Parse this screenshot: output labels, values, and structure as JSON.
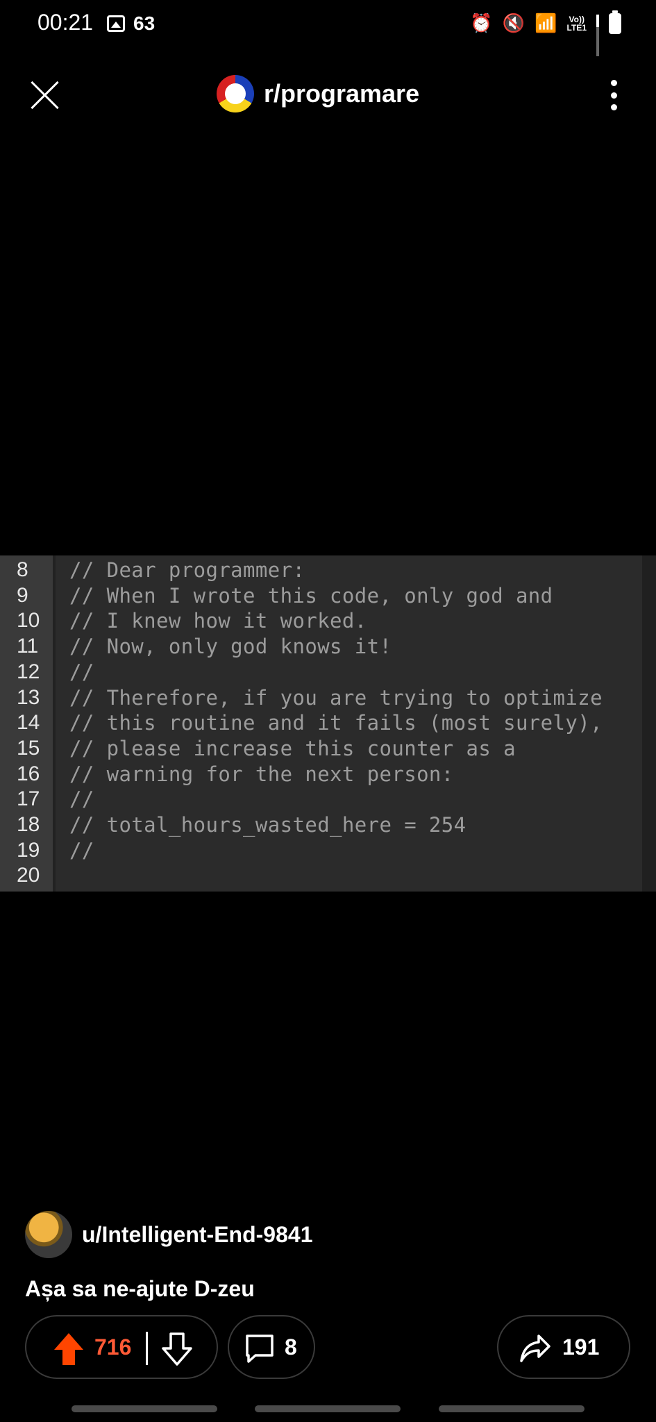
{
  "status_bar": {
    "time": "00:21",
    "notification_count": "63",
    "network_label_top": "Vo))",
    "network_label_bottom": "LTE1"
  },
  "header": {
    "subreddit": "r/programare",
    "icons": [
      "close-icon",
      "more-icon"
    ]
  },
  "code_image": {
    "lines": [
      {
        "num": "8",
        "text": "// Dear programmer:"
      },
      {
        "num": "9",
        "text": "// When I wrote this code, only god and"
      },
      {
        "num": "10",
        "text": "// I knew how it worked."
      },
      {
        "num": "11",
        "text": "// Now, only god knows it!"
      },
      {
        "num": "12",
        "text": "//"
      },
      {
        "num": "13",
        "text": "// Therefore, if you are trying to optimize"
      },
      {
        "num": "14",
        "text": "// this routine and it fails (most surely),"
      },
      {
        "num": "15",
        "text": "// please increase this counter as a"
      },
      {
        "num": "16",
        "text": "// warning for the next person:"
      },
      {
        "num": "17",
        "text": "//"
      },
      {
        "num": "18",
        "text": "// total_hours_wasted_here = 254"
      },
      {
        "num": "19",
        "text": "//"
      },
      {
        "num": "20",
        "text": ""
      }
    ]
  },
  "post": {
    "author": "u/Intelligent-End-9841",
    "title": "Așa sa ne-ajute D-zeu"
  },
  "actions": {
    "upvotes": "716",
    "comments": "8",
    "shares": "191",
    "upvote_color": "#ff4500"
  }
}
